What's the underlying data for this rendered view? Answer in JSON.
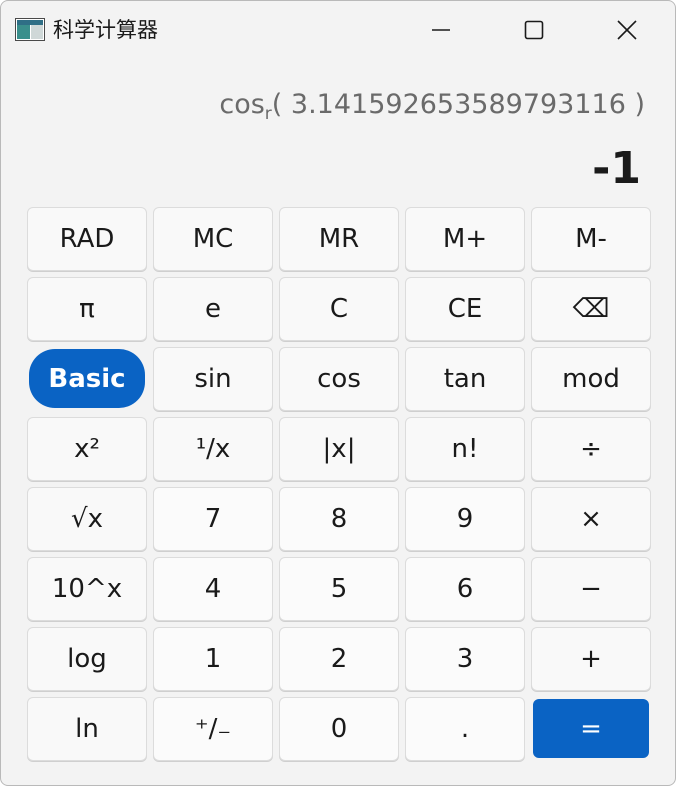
{
  "window": {
    "title": "科学计算器",
    "accent_color": "#0a63c4",
    "icons": {
      "app": "calculator-app-icon",
      "minimize": "minimize-icon",
      "maximize": "maximize-icon",
      "close": "close-icon"
    }
  },
  "display": {
    "expression_func": "cos",
    "expression_sub": "r",
    "expression_arg": "( 3.141592653589793116 )",
    "result": "-1"
  },
  "keys": [
    {
      "label": "RAD",
      "name": "rad-button",
      "style": ""
    },
    {
      "label": "MC",
      "name": "memory-clear-button",
      "style": ""
    },
    {
      "label": "MR",
      "name": "memory-recall-button",
      "style": ""
    },
    {
      "label": "M+",
      "name": "memory-add-button",
      "style": ""
    },
    {
      "label": "M-",
      "name": "memory-subtract-button",
      "style": ""
    },
    {
      "label": "π",
      "name": "pi-button",
      "style": ""
    },
    {
      "label": "e",
      "name": "euler-button",
      "style": ""
    },
    {
      "label": "C",
      "name": "clear-button",
      "style": ""
    },
    {
      "label": "CE",
      "name": "clear-entry-button",
      "style": ""
    },
    {
      "label": "⌫",
      "name": "backspace-button",
      "style": ""
    },
    {
      "label": "Basic",
      "name": "basic-mode-button",
      "style": "active"
    },
    {
      "label": "sin",
      "name": "sin-button",
      "style": ""
    },
    {
      "label": "cos",
      "name": "cos-button",
      "style": ""
    },
    {
      "label": "tan",
      "name": "tan-button",
      "style": ""
    },
    {
      "label": "mod",
      "name": "mod-button",
      "style": ""
    },
    {
      "label": "x²",
      "name": "square-button",
      "style": ""
    },
    {
      "label": "¹/x",
      "name": "reciprocal-button",
      "style": ""
    },
    {
      "label": "|x|",
      "name": "absolute-button",
      "style": ""
    },
    {
      "label": "n!",
      "name": "factorial-button",
      "style": ""
    },
    {
      "label": "÷",
      "name": "divide-button",
      "style": ""
    },
    {
      "label": "√x",
      "name": "sqrt-button",
      "style": ""
    },
    {
      "label": "7",
      "name": "digit-7-button",
      "style": "light"
    },
    {
      "label": "8",
      "name": "digit-8-button",
      "style": "light"
    },
    {
      "label": "9",
      "name": "digit-9-button",
      "style": "light"
    },
    {
      "label": "×",
      "name": "multiply-button",
      "style": ""
    },
    {
      "label": "10^x",
      "name": "power-of-ten-button",
      "style": ""
    },
    {
      "label": "4",
      "name": "digit-4-button",
      "style": "light"
    },
    {
      "label": "5",
      "name": "digit-5-button",
      "style": "light"
    },
    {
      "label": "6",
      "name": "digit-6-button",
      "style": "light"
    },
    {
      "label": "−",
      "name": "subtract-button",
      "style": ""
    },
    {
      "label": "log",
      "name": "log-button",
      "style": ""
    },
    {
      "label": "1",
      "name": "digit-1-button",
      "style": "light"
    },
    {
      "label": "2",
      "name": "digit-2-button",
      "style": "light"
    },
    {
      "label": "3",
      "name": "digit-3-button",
      "style": "light"
    },
    {
      "label": "+",
      "name": "add-button",
      "style": ""
    },
    {
      "label": "ln",
      "name": "ln-button",
      "style": ""
    },
    {
      "label": "⁺/₋",
      "name": "negate-button",
      "style": "light"
    },
    {
      "label": "0",
      "name": "digit-0-button",
      "style": "light"
    },
    {
      "label": ".",
      "name": "decimal-button",
      "style": "light"
    },
    {
      "label": "=",
      "name": "equals-button",
      "style": "equals"
    }
  ]
}
